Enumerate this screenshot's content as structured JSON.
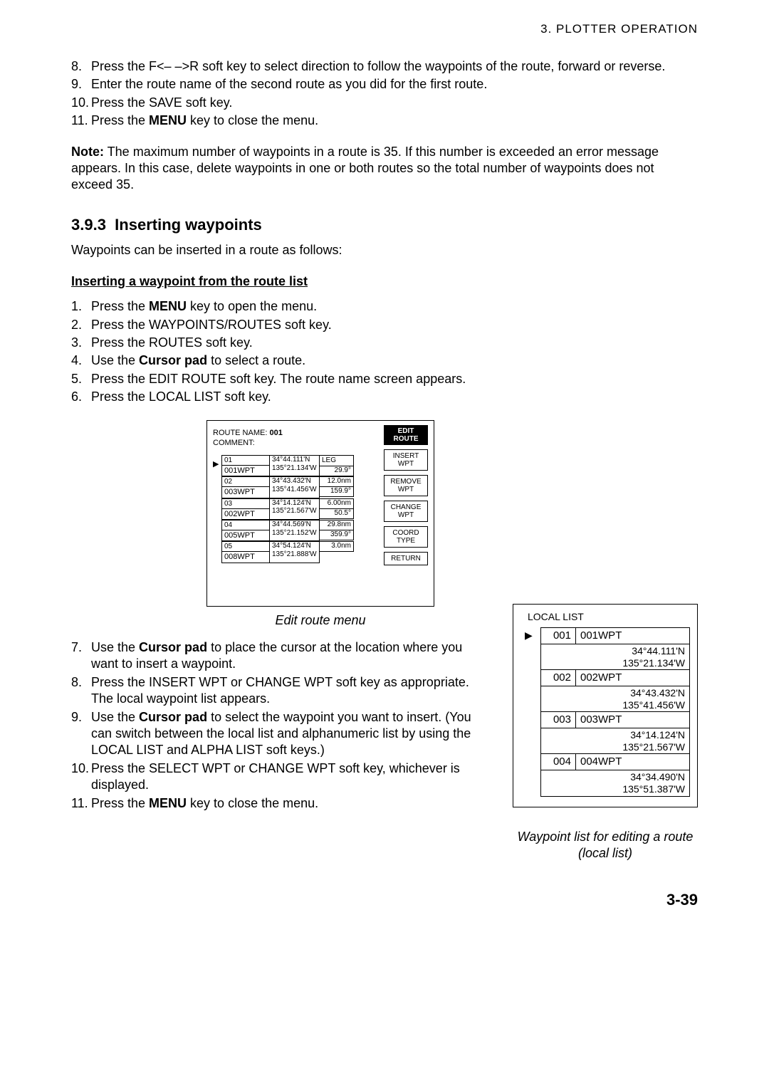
{
  "header": {
    "section": "3.  PLOTTER  OPERATION"
  },
  "steps_a": [
    {
      "n": "8.",
      "t_pre": "Press the F<– –>R soft key to select direction to follow the waypoints of the route, forward or reverse."
    },
    {
      "n": "9.",
      "t_pre": "Enter the route name of the second route as you did for the first route."
    },
    {
      "n": "10.",
      "t_pre": "Press the SAVE soft key."
    },
    {
      "n": "11.",
      "t_pre": "Press the ",
      "bold": "MENU",
      "t_post": " key to close the menu."
    }
  ],
  "note": {
    "label": "Note:",
    "text": " The maximum number of waypoints in a route is 35. If this number is exceeded an error message appears. In this case, delete waypoints in one or both routes so the total number of waypoints does not exceed 35."
  },
  "section": {
    "num": "3.9.3",
    "title": "Inserting waypoints",
    "intro": "Waypoints can be inserted in a route as follows:"
  },
  "subheading": "Inserting a waypoint from the route list",
  "steps_b": [
    {
      "n": "1.",
      "t_pre": "Press the ",
      "bold": "MENU",
      "t_post": " key to open the menu."
    },
    {
      "n": "2.",
      "t_pre": "Press the WAYPOINTS/ROUTES soft key."
    },
    {
      "n": "3.",
      "t_pre": "Press the ROUTES soft key."
    },
    {
      "n": "4.",
      "t_pre": "Use the ",
      "bold": "Cursor pad",
      "t_post": " to select a route."
    },
    {
      "n": "5.",
      "t_pre": "Press the EDIT ROUTE soft key. The route name screen appears."
    },
    {
      "n": "6.",
      "t_pre": "Press the LOCAL LIST soft key."
    }
  ],
  "edit_route": {
    "route_name_label": "ROUTE NAME:",
    "route_name": "001",
    "comment_label": "COMMENT:",
    "soft_header": "EDIT ROUTE",
    "softkeys": [
      "INSERT WPT",
      "REMOVE WPT",
      "CHANGE WPT",
      "COORD TYPE",
      "RETURN"
    ],
    "rows": [
      {
        "ptr": "▶",
        "idx": "01",
        "wpt": "001WPT",
        "lat": "34°44.111'N",
        "lon": "135°21.134'W",
        "leg": "LEG",
        "brg": "29.9°",
        "dist": "12.0nm"
      },
      {
        "ptr": "",
        "idx": "02",
        "wpt": "003WPT",
        "lat": "34°43.432'N",
        "lon": "135°41.456'W",
        "leg": "",
        "brg": "159.9°",
        "dist": "6.00nm"
      },
      {
        "ptr": "",
        "idx": "03",
        "wpt": "002WPT",
        "lat": "34°14.124'N",
        "lon": "135°21.567'W",
        "leg": "",
        "brg": "50.5°",
        "dist": "29.8nm"
      },
      {
        "ptr": "",
        "idx": "04",
        "wpt": "005WPT",
        "lat": "34°44.569'N",
        "lon": "135°21.152'W",
        "leg": "",
        "brg": "359.9°",
        "dist": "3.0nm"
      },
      {
        "ptr": "",
        "idx": "05",
        "wpt": "008WPT",
        "lat": "34°54.124'N",
        "lon": "135°21.888'W",
        "leg": "",
        "brg": "",
        "dist": ""
      }
    ],
    "caption": "Edit route menu"
  },
  "steps_c": [
    {
      "n": "7.",
      "t_pre": "Use the ",
      "bold": "Cursor pad",
      "t_post": " to place the cursor at the location where you want to insert a waypoint."
    },
    {
      "n": "8.",
      "t_pre": "Press the INSERT WPT or CHANGE WPT soft key as appropriate. The local waypoint list appears."
    },
    {
      "n": "9.",
      "t_pre": "Use the ",
      "bold": "Cursor pad",
      "t_post": " to select the waypoint you want to insert. (You can switch between the local list and alphanumeric list by using the LOCAL LIST and ALPHA LIST soft keys.)"
    },
    {
      "n": "10.",
      "t_pre": "Press the SELECT WPT or CHANGE WPT soft key, whichever is displayed."
    },
    {
      "n": "11.",
      "t_pre": "Press the ",
      "bold": "MENU",
      "t_post": " key to close the menu."
    }
  ],
  "local_list": {
    "title": "LOCAL LIST",
    "rows": [
      {
        "ptr": "▶",
        "num": "001",
        "wpt": "001WPT",
        "lat": "34°44.111'N",
        "lon": "135°21.134'W"
      },
      {
        "ptr": "",
        "num": "002",
        "wpt": "002WPT",
        "lat": "34°43.432'N",
        "lon": "135°41.456'W"
      },
      {
        "ptr": "",
        "num": "003",
        "wpt": "003WPT",
        "lat": "34°14.124'N",
        "lon": "135°21.567'W"
      },
      {
        "ptr": "",
        "num": "004",
        "wpt": "004WPT",
        "lat": "34°34.490'N",
        "lon": "135°51.387'W"
      }
    ],
    "caption": "Waypoint list for editing a route (local list)"
  },
  "page_number": "3-39"
}
